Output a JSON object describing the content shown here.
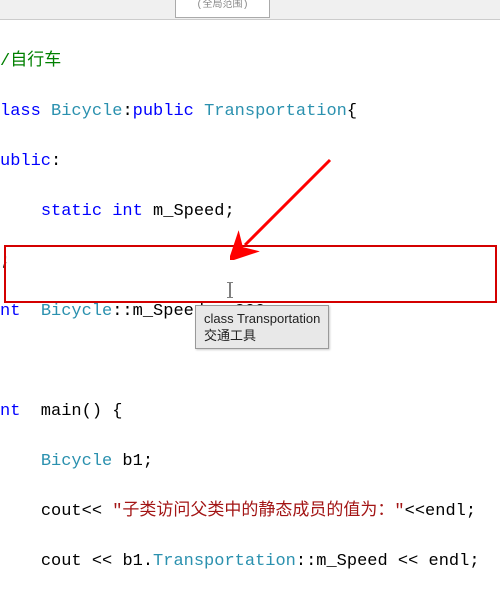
{
  "tab_remnant": "(全局范围)",
  "code": {
    "l1_comment": "/自行车",
    "l2_kw_class": "lass ",
    "l2_type_bicycle": "Bicycle",
    "l2_colon": ":",
    "l2_kw_public": "public ",
    "l2_type_trans": "Transportation",
    "l2_brace": "{",
    "l3_kw_public": "ublic",
    "l3_colon": ":",
    "l4_indent": "    ",
    "l4_kw_static": "static ",
    "l4_kw_int": "int ",
    "l4_ident": "m_Speed;",
    "l5_semi": ";",
    "l6_kw_int": "nt  ",
    "l6_type": "Bicycle",
    "l6_scope": "::m_Speed = ",
    "l6_num": "200",
    "l6_semi": ";",
    "l8_kw_int": "nt ",
    "l8_main": " main() {",
    "l9_indent": "    ",
    "l9_type": "Bicycle",
    "l9_ident": " b1;",
    "l10_indent": "    ",
    "l10_cout": "cout",
    "l10_op1": "<< ",
    "l10_str": "\"子类访问父类中的静态成员的值为：\"",
    "l10_op2": "<<",
    "l10_endl": "endl",
    "l10_semi": ";",
    "l11_indent": "    ",
    "l11_cout": "cout ",
    "l11_op1": "<< ",
    "l11_b1": "b1.",
    "l11_type": "Transportation",
    "l11_scope": "::m_Speed ",
    "l11_op2": "<< ",
    "l11_endl": "endl",
    "l11_semi": ";"
  },
  "tooltip": {
    "line1": "class Transportation",
    "line2": "交通工具"
  },
  "colors": {
    "highlight": "#d40000",
    "arrow": "#ff0000"
  }
}
